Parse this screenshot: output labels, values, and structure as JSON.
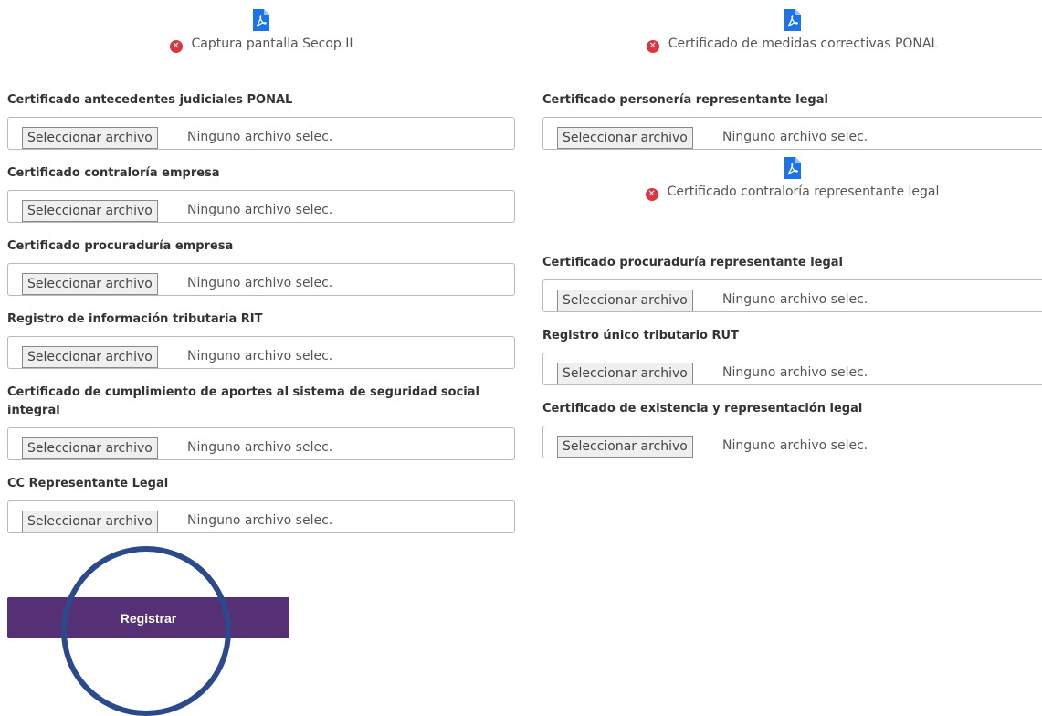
{
  "left_column": {
    "uploaded": {
      "name": "Captura pantalla Secop II"
    },
    "fields": [
      {
        "label": "Certificado antecedentes judiciales PONAL",
        "button": "Seleccionar archivo",
        "status": "Ninguno archivo selec."
      },
      {
        "label": "Certificado contraloría empresa",
        "button": "Seleccionar archivo",
        "status": "Ninguno archivo selec."
      },
      {
        "label": "Certificado procuraduría empresa",
        "button": "Seleccionar archivo",
        "status": "Ninguno archivo selec."
      },
      {
        "label": "Registro de información tributaria RIT",
        "button": "Seleccionar archivo",
        "status": "Ninguno archivo selec."
      },
      {
        "label": "Certificado de cumplimiento de aportes al sistema de seguridad social integral",
        "button": "Seleccionar archivo",
        "status": "Ninguno archivo selec."
      },
      {
        "label": "CC Representante Legal",
        "button": "Seleccionar archivo",
        "status": "Ninguno archivo selec."
      }
    ]
  },
  "right_column": {
    "uploaded_top": {
      "name": "Certificado de medidas correctivas PONAL"
    },
    "field_personeria": {
      "label": "Certificado personería representante legal",
      "button": "Seleccionar archivo",
      "status": "Ninguno archivo selec."
    },
    "uploaded_mid": {
      "name": "Certificado contraloría representante legal"
    },
    "fields": [
      {
        "label": "Certificado procuraduría representante legal",
        "button": "Seleccionar archivo",
        "status": "Ninguno archivo selec."
      },
      {
        "label": "Registro único tributario RUT",
        "button": "Seleccionar archivo",
        "status": "Ninguno archivo selec."
      },
      {
        "label": "Certificado de existencia y representación legal",
        "button": "Seleccionar archivo",
        "status": "Ninguno archivo selec."
      }
    ]
  },
  "submit": {
    "label": "Registrar"
  },
  "icons": {
    "pdf": "pdf-file-icon",
    "remove": "remove-x-icon"
  },
  "colors": {
    "submit_bg": "#553074",
    "remove_red": "#d9363e",
    "pdf_blue": "#1a73e8",
    "annotation_circle": "#2a4a8c"
  }
}
